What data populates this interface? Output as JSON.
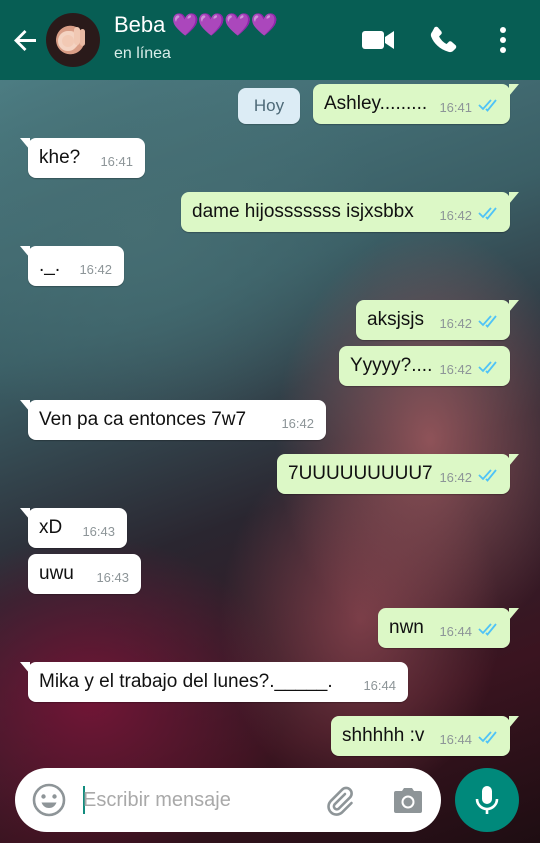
{
  "header": {
    "contact_name": "Beba",
    "hearts": "💜💜💜💜",
    "status": "en línea"
  },
  "date_chip": "Hoy",
  "messages": [
    {
      "dir": "out",
      "text": "Ashley.........",
      "time": "16:41"
    },
    {
      "dir": "in",
      "text": "khe?",
      "time": "16:41"
    },
    {
      "dir": "out",
      "text": "dame hijosssssss isjxsbbx",
      "time": "16:42"
    },
    {
      "dir": "in",
      "text": "._.",
      "time": "16:42"
    },
    {
      "dir": "out",
      "text": "aksjsjs",
      "time": "16:42"
    },
    {
      "dir": "out",
      "text": "Yyyyy?....",
      "time": "16:42"
    },
    {
      "dir": "in",
      "text": "Ven pa ca entonces 7w7",
      "time": "16:42"
    },
    {
      "dir": "out",
      "text": "7UUUUUUUUU7",
      "time": "16:42"
    },
    {
      "dir": "in",
      "text": "xD",
      "time": "16:43"
    },
    {
      "dir": "in",
      "text": "uwu",
      "time": "16:43"
    },
    {
      "dir": "out",
      "text": "nwn",
      "time": "16:44"
    },
    {
      "dir": "in",
      "text": "Mika y el trabajo del lunes?._____.",
      "time": "16:44"
    },
    {
      "dir": "out",
      "text": "shhhhh :v",
      "time": "16:44"
    }
  ],
  "composer": {
    "placeholder": "Escribir mensaje"
  },
  "colors": {
    "header": "#075e54",
    "outgoing_bubble": "#dcf8c6",
    "incoming_bubble": "#ffffff",
    "read_ticks": "#4fc3f7",
    "mic_button": "#00897b"
  },
  "icons": [
    "back-arrow-icon",
    "video-call-icon",
    "phone-icon",
    "more-options-icon",
    "emoji-icon",
    "attach-clip-icon",
    "camera-icon",
    "microphone-icon",
    "double-check-icon"
  ]
}
